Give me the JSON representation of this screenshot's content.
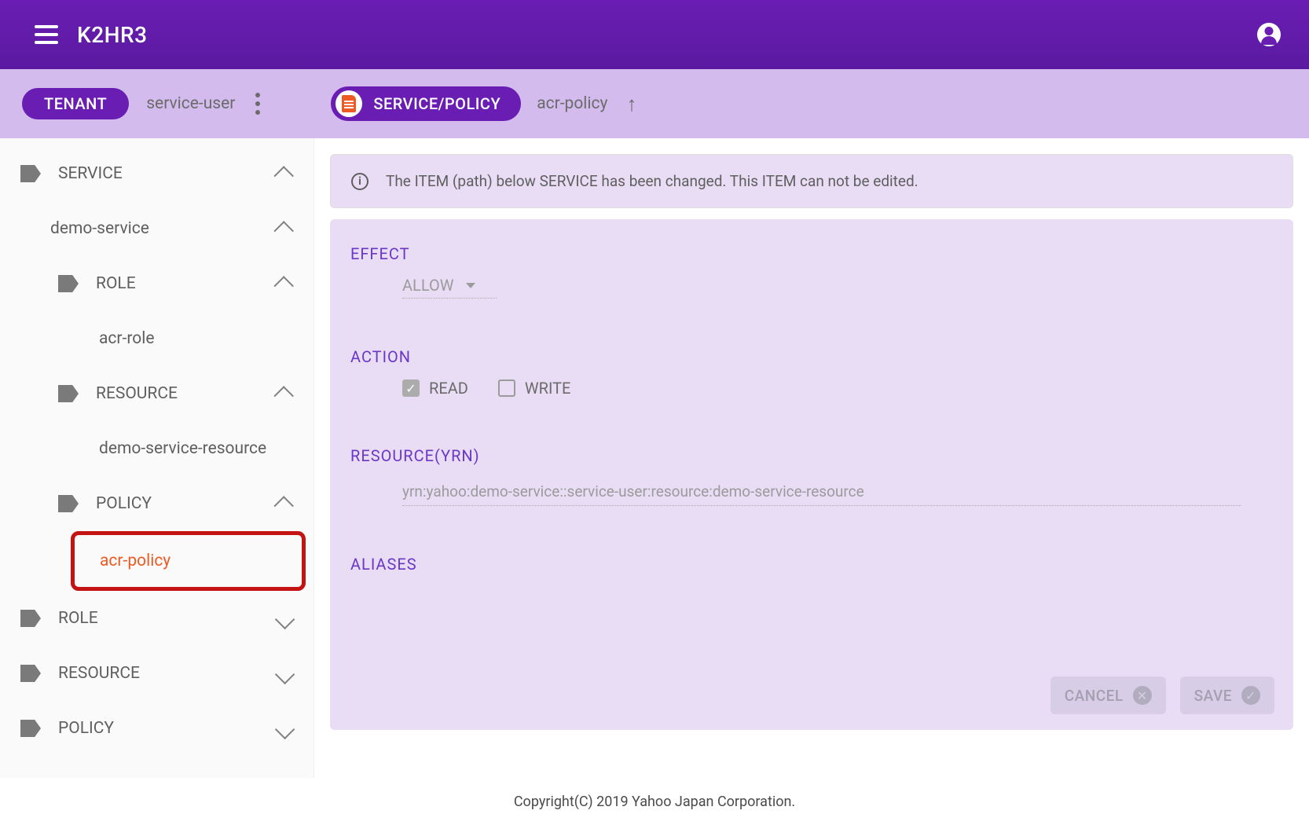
{
  "app": {
    "title": "K2HR3"
  },
  "tenant": {
    "chip_label": "TENANT",
    "name": "service-user"
  },
  "breadcrumb": {
    "chip_label": "SERVICE/POLICY",
    "name": "acr-policy"
  },
  "sidebar": {
    "service": "SERVICE",
    "demo_service": "demo-service",
    "role": "ROLE",
    "acr_role": "acr-role",
    "resource": "RESOURCE",
    "demo_resource": "demo-service-resource",
    "policy": "POLICY",
    "acr_policy": "acr-policy",
    "root_role": "ROLE",
    "root_resource": "RESOURCE",
    "root_policy": "POLICY"
  },
  "info_banner": "The ITEM (path) below SERVICE has been changed. This ITEM can not be edited.",
  "form": {
    "effect_label": "EFFECT",
    "effect_value": "ALLOW",
    "action_label": "ACTION",
    "action_read": "READ",
    "action_write": "WRITE",
    "resource_label": "RESOURCE(YRN)",
    "resource_value": "yrn:yahoo:demo-service::service-user:resource:demo-service-resource",
    "aliases_label": "ALIASES"
  },
  "buttons": {
    "cancel": "CANCEL",
    "save": "SAVE"
  },
  "footer": "Copyright(C) 2019 Yahoo Japan Corporation."
}
